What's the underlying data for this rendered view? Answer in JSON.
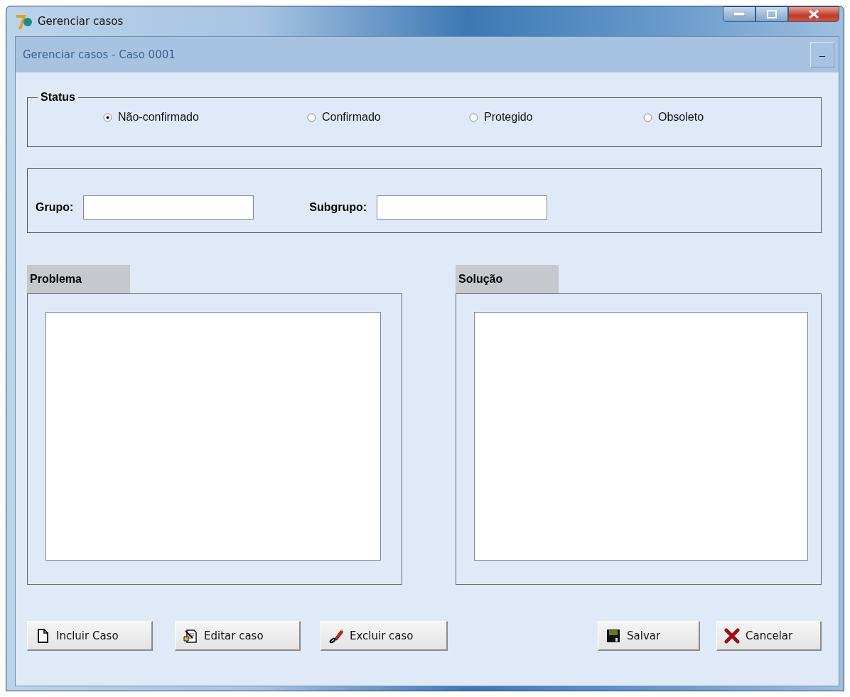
{
  "window": {
    "title": "Gerenciar casos"
  },
  "header": {
    "title": "Gerenciar casos - Caso 0001",
    "collapse_button": "–"
  },
  "status": {
    "legend": "Status",
    "options": [
      {
        "label": "Não-confirmado",
        "selected": true
      },
      {
        "label": "Confirmado",
        "selected": false
      },
      {
        "label": "Protegido",
        "selected": false
      },
      {
        "label": "Obsoleto",
        "selected": false
      }
    ]
  },
  "fields": [
    {
      "label": "Grupo:"
    },
    {
      "label": "Subgrupo:"
    }
  ],
  "panels": [
    {
      "tab": "Problema"
    },
    {
      "tab": "Solução"
    }
  ],
  "buttons_left": [
    {
      "label": "Incluir Caso",
      "kind": "new"
    },
    {
      "label": "Editar caso",
      "kind": "edit"
    },
    {
      "label": "Excluir caso",
      "kind": "delete"
    }
  ],
  "buttons_right": [
    {
      "label": "Salvar",
      "kind": "save"
    },
    {
      "label": "Cancelar",
      "kind": "cancel"
    }
  ]
}
